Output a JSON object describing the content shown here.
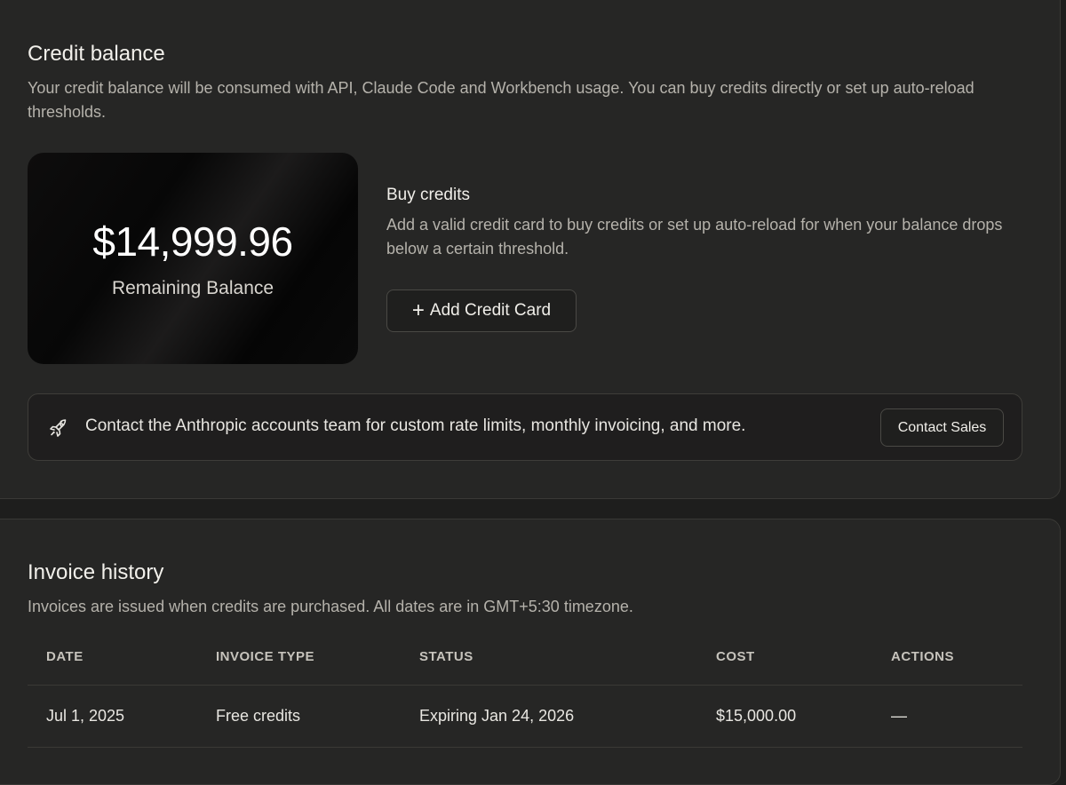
{
  "credit_balance": {
    "title": "Credit balance",
    "description": "Your credit balance will be consumed with API, Claude Code and Workbench usage. You can buy credits directly or set up auto-reload thresholds.",
    "balance_amount": "$14,999.96",
    "balance_label": "Remaining Balance",
    "buy_credits": {
      "title": "Buy credits",
      "description": "Add a valid credit card to buy credits or set up auto-reload for when your balance drops below a certain threshold.",
      "add_card_label": "Add Credit Card"
    },
    "contact": {
      "icon": "rocket-icon",
      "text": "Contact the Anthropic accounts team for custom rate limits, monthly invoicing, and more.",
      "button_label": "Contact Sales"
    }
  },
  "invoice_history": {
    "title": "Invoice history",
    "description": "Invoices are issued when credits are purchased. All dates are in GMT+5:30 timezone.",
    "columns": [
      "DATE",
      "INVOICE TYPE",
      "STATUS",
      "COST",
      "ACTIONS"
    ],
    "rows": [
      [
        "Jul 1, 2025",
        "Free credits",
        "Expiring Jan 24, 2026",
        "$15,000.00",
        "—"
      ]
    ]
  },
  "colors": {
    "background": "#1e1e1d",
    "panel": "#262625",
    "border": "#3a3936",
    "text_primary": "#f2f0eb",
    "text_secondary": "#b5b2ab"
  }
}
